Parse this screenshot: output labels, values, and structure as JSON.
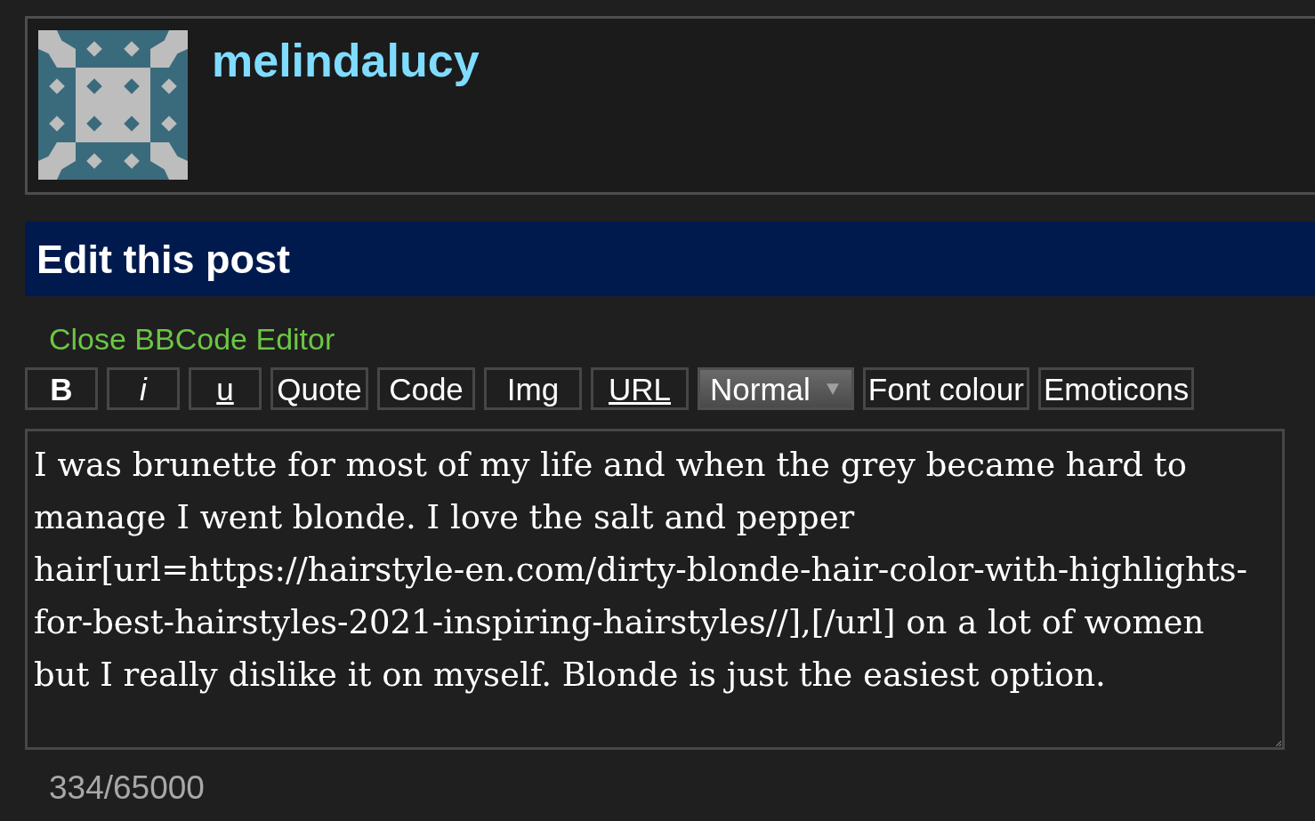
{
  "profile": {
    "username": "melindalucy"
  },
  "header": {
    "title": "Edit this post"
  },
  "editor_toggle": {
    "label": "Close BBCode Editor"
  },
  "toolbar": [
    {
      "kind": "bold",
      "label": "B"
    },
    {
      "kind": "italic",
      "label": "i"
    },
    {
      "kind": "underline",
      "label": "u"
    },
    {
      "kind": "plain",
      "label": "Quote"
    },
    {
      "kind": "plain",
      "label": "Code"
    },
    {
      "kind": "plain",
      "label": "Img"
    },
    {
      "kind": "link",
      "label": "URL"
    },
    {
      "kind": "dropdown",
      "label": "Normal"
    },
    {
      "kind": "plain",
      "label": "Font colour"
    },
    {
      "kind": "plain",
      "label": "Emoticons"
    }
  ],
  "post_body": {
    "value": "I was brunette for most of my life and when the grey became hard to manage I went blonde. I love the salt and pepper hair[url=https://hairstyle-en.com/dirty-blonde-hair-color-with-highlights-for-best-hairstyles-2021-inspiring-hairstyles//],[/url] on a lot of women but I really dislike it on myself. Blonde is just the easiest option."
  },
  "character_count": "334/65000"
}
